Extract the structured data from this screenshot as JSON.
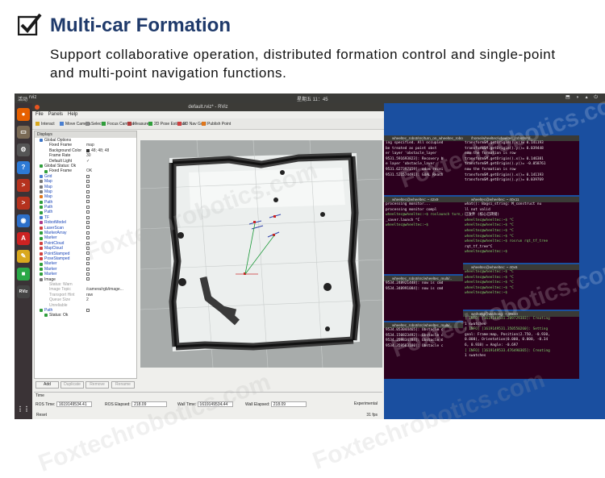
{
  "header": {
    "title": "Multi-car Formation",
    "subtitle": "Support collaborative operation, distributed formation control and single-point and multi-point navigation functions."
  },
  "topbar": {
    "activities": "活动",
    "app": "rviz",
    "clock": "星期五 11：45",
    "tray": "⬒ ◗ ▴ ⏻"
  },
  "launcher": {
    "icons": [
      {
        "name": "firefox-icon",
        "color": "#e66000",
        "glyph": "●"
      },
      {
        "name": "files-icon",
        "color": "#7a6a55",
        "glyph": "▭"
      },
      {
        "name": "settings-icon",
        "color": "#555555",
        "glyph": "⚙"
      },
      {
        "name": "help-icon",
        "color": "#2d7ad6",
        "glyph": "?"
      },
      {
        "name": "terminal-icon-1",
        "color": "#b5321e",
        "glyph": ">"
      },
      {
        "name": "terminal-icon-2",
        "color": "#b5321e",
        "glyph": ">"
      },
      {
        "name": "app-icon",
        "color": "#2d6fc9",
        "glyph": "◉"
      },
      {
        "name": "store-icon",
        "color": "#cc2222",
        "glyph": "A"
      },
      {
        "name": "editor-icon",
        "color": "#d9a81e",
        "glyph": "✎"
      },
      {
        "name": "app-green-icon",
        "color": "#2aa847",
        "glyph": "■"
      },
      {
        "name": "rviz-icon",
        "color": "#444444",
        "glyph": "RViz"
      }
    ],
    "apps_grid": "⋮⋮"
  },
  "rviz": {
    "window_title": "default.rviz* - RViz",
    "menu": [
      "File",
      "Panels",
      "Help"
    ],
    "toolbar": [
      "Interact",
      "Move Camera",
      "Select",
      "Focus Camera",
      "Measure",
      "2D Pose Estimate",
      "2D Nav Goal",
      "Publish Point"
    ],
    "displays_title": "Displays",
    "displays": [
      {
        "label": "Global Options",
        "indent": 1,
        "dot": "#3b73c7",
        "cls": ""
      },
      {
        "label": "Fixed Frame",
        "indent": 2,
        "value": "map",
        "cls": ""
      },
      {
        "label": "Background Color",
        "indent": 2,
        "value": "48; 48; 48",
        "swatch": true,
        "cls": ""
      },
      {
        "label": "Frame Rate",
        "indent": 2,
        "value": "30",
        "cls": ""
      },
      {
        "label": "Default Light",
        "indent": 2,
        "value": "✓",
        "cls": ""
      },
      {
        "label": "Global Status: Ok",
        "indent": 1,
        "dot": "#2f9e3b",
        "cls": ""
      },
      {
        "label": "Fixed Frame",
        "indent": 2,
        "value": "OK",
        "dot": "#2f9e3b",
        "cls": ""
      },
      {
        "label": "Grid",
        "indent": 1,
        "dot": "#4a7fd0",
        "check": true,
        "cls": "blue"
      },
      {
        "label": "Map",
        "indent": 1,
        "dot": "#777777",
        "check": true,
        "cls": "blue"
      },
      {
        "label": "Map",
        "indent": 1,
        "dot": "#777777",
        "check": true,
        "cls": "blue"
      },
      {
        "label": "Map",
        "indent": 1,
        "dot": "#777777",
        "check": true,
        "cls": "blue"
      },
      {
        "label": "Map",
        "indent": 1,
        "dot": "#e0761a",
        "check": true,
        "cls": "blue"
      },
      {
        "label": "Path",
        "indent": 1,
        "dot": "#2f9e3b",
        "check": true,
        "cls": "blue"
      },
      {
        "label": "Path",
        "indent": 1,
        "dot": "#2f9e3b",
        "check": true,
        "cls": "blue"
      },
      {
        "label": "Path",
        "indent": 1,
        "dot": "#2f9e3b",
        "check": true,
        "cls": "blue"
      },
      {
        "label": "TF",
        "indent": 1,
        "dot": "#4a7fd0",
        "check": true,
        "cls": "blue"
      },
      {
        "label": "RobotModel",
        "indent": 1,
        "dot": "#b03a8a",
        "check": true,
        "cls": "blue"
      },
      {
        "label": "LaserScan",
        "indent": 1,
        "dot": "#d04040",
        "check": true,
        "cls": "blue"
      },
      {
        "label": "MarkerArray",
        "indent": 1,
        "dot": "#2f9e3b",
        "check": true,
        "cls": "blue"
      },
      {
        "label": "Marker",
        "indent": 1,
        "dot": "#2f9e3b",
        "check": true,
        "cls": "blue"
      },
      {
        "label": "PointCloud",
        "indent": 1,
        "dot": "#d04040",
        "check": true,
        "cls": "blue"
      },
      {
        "label": "MapCloud",
        "indent": 1,
        "dot": "#d04040",
        "check": true,
        "cls": "blue"
      },
      {
        "label": "PointStamped",
        "indent": 1,
        "dot": "#d04040",
        "check": true,
        "cls": "blue"
      },
      {
        "label": "PoseStamped",
        "indent": 1,
        "dot": "#d04040",
        "check": true,
        "cls": "blue"
      },
      {
        "label": "Marker",
        "indent": 1,
        "dot": "#2f9e3b",
        "check": true,
        "cls": "blue"
      },
      {
        "label": "Marker",
        "indent": 1,
        "dot": "#2f9e3b",
        "check": true,
        "cls": "blue"
      },
      {
        "label": "Marker",
        "indent": 1,
        "dot": "#2f9e3b",
        "check": true,
        "cls": "blue"
      },
      {
        "label": "Image",
        "indent": 1,
        "dot": "#777777",
        "check": true,
        "cls": ""
      },
      {
        "label": "Status: Warn",
        "indent": 2,
        "cls": "grey"
      },
      {
        "label": "Image Topic",
        "indent": 2,
        "value": "/camera/rgb/image...",
        "cls": "grey"
      },
      {
        "label": "Transport Hint",
        "indent": 2,
        "value": "raw",
        "cls": "grey"
      },
      {
        "label": "Queue Size",
        "indent": 2,
        "value": "2",
        "cls": "grey"
      },
      {
        "label": "Unreliable",
        "indent": 2,
        "cls": "grey"
      },
      {
        "label": "Path",
        "indent": 1,
        "dot": "#2f9e3b",
        "check": true,
        "cls": "blue"
      },
      {
        "label": "Status: Ok",
        "indent": 2,
        "dot": "#2f9e3b",
        "cls": ""
      }
    ],
    "buttons": [
      "Add",
      "Duplicate",
      "Remove",
      "Rename"
    ],
    "time": {
      "header": "Time",
      "ros_time_label": "ROS Time:",
      "ros_time": "1619149534.41",
      "ros_elapsed_label": "ROS Elapsed:",
      "ros_elapsed": "218.09",
      "wall_time_label": "Wall Time:",
      "wall_time": "1619149534.44",
      "wall_elapsed_label": "Wall Elapsed:",
      "wall_elapsed": "218.09",
      "experimental": "Experimental",
      "reset": "Reset",
      "fps": "31 fps"
    }
  },
  "terminals": [
    {
      "title": "wheeltec_robot/src/turn_on_wheeltec_robot/launch/...",
      "lines": [
        "ing specified. All occupied",
        "be treated as point obst",
        "er layer 'obstacle_layer",
        "9531.591693823]: Recovery b",
        "e layer 'obstacle_layer",
        "9531.627397159]: odom recei",
        "",
        "9531.521574491]: GOAL Reach"
      ]
    },
    {
      "title": "/home/wheeltec/wheeltec_robot/src/..",
      "lines": [
        "transformSM.getOrigin().x()= 0.141193",
        "transformSM.getOrigin().y()= 0.039448",
        "now the formation is row",
        "transformSM.getOrigin().x()= 0.146381",
        "transformSM.getOrigin().y()= -0.058761",
        "now the formation is row",
        "transformSM.getOrigin().x()= 0.141193",
        "transformSM.getOrigin().y()= 0.039769"
      ]
    },
    {
      "title": "wheeltec@wheeltec: ~ 42x9",
      "lines": [
        "",
        "processing monitor...",
        "processing monitor compl",
        "",
        "wheeltec@wheeltec:~$ roslaunch turn_on_whe",
        "_saver.launch ^C",
        "wheeltec@wheeltec:~$"
      ]
    },
    {
      "title": "wheeltec@wheeltec: ~ 40x11",
      "lines": [
        "what(): Bagsi_string: M_construct nu",
        "ll not valid",
        "已放弃 (核心已转储)",
        "wheeltec@wheeltec:~$ ^C",
        "wheeltec@wheeltec:~$ ^C",
        "wheeltec@wheeltec:~$ ^C",
        "wheeltec@wheeltec:~$ ^C",
        "wheeltec@wheeltec:~$ rosrun rqt_tf_tree",
        "rqt_tf_tree^C",
        "wheeltec@wheeltec:~$"
      ]
    },
    {
      "title": "wheeltec_robot/src/wheeltec_multi/..",
      "lines": [
        "",
        "9534.248921448]: now is cmd",
        "",
        "9534.348991084]: now is cmd",
        ""
      ]
    },
    {
      "title": "wheeltec@wheeltec: ~ 40x6",
      "lines": [
        "wheeltec@wheeltec:~$ ^C",
        "wheeltec@wheeltec:~$ ^C",
        "wheeltec@wheeltec:~$ ^C",
        "wheeltec@wheeltec:~$ ^C",
        "wheeltec@wheeltec:~$"
      ]
    },
    {
      "title": "wheeltec_robot/src/wheeltec_multi/..",
      "lines": [
        "",
        "9534.053044465]: Obstacle c",
        "",
        "9534.150823492]: Obstacle c",
        "",
        "9534.259834784]: Obstacle c",
        "",
        "9534.359583180]: Obstacle c"
      ]
    },
    {
      "title": "weihong@weihong: ~ 40x10",
      "lines": [
        "[ INFO] [1619149531.209729383]: Creating",
        "1 swatches",
        "[ INFO] [1619149531.350550260]: Setting",
        "goal: Frame:map, Position(2.750, -0.930,",
        "0.000), Orientation(0.000, 0.000, -0.34",
        "6, 0.938) = Angle: -0.697",
        "",
        "[ INFO] [1619149533.476490365]: Creating",
        "1 swatches"
      ]
    }
  ],
  "watermark": "Foxtechrobotics.com"
}
